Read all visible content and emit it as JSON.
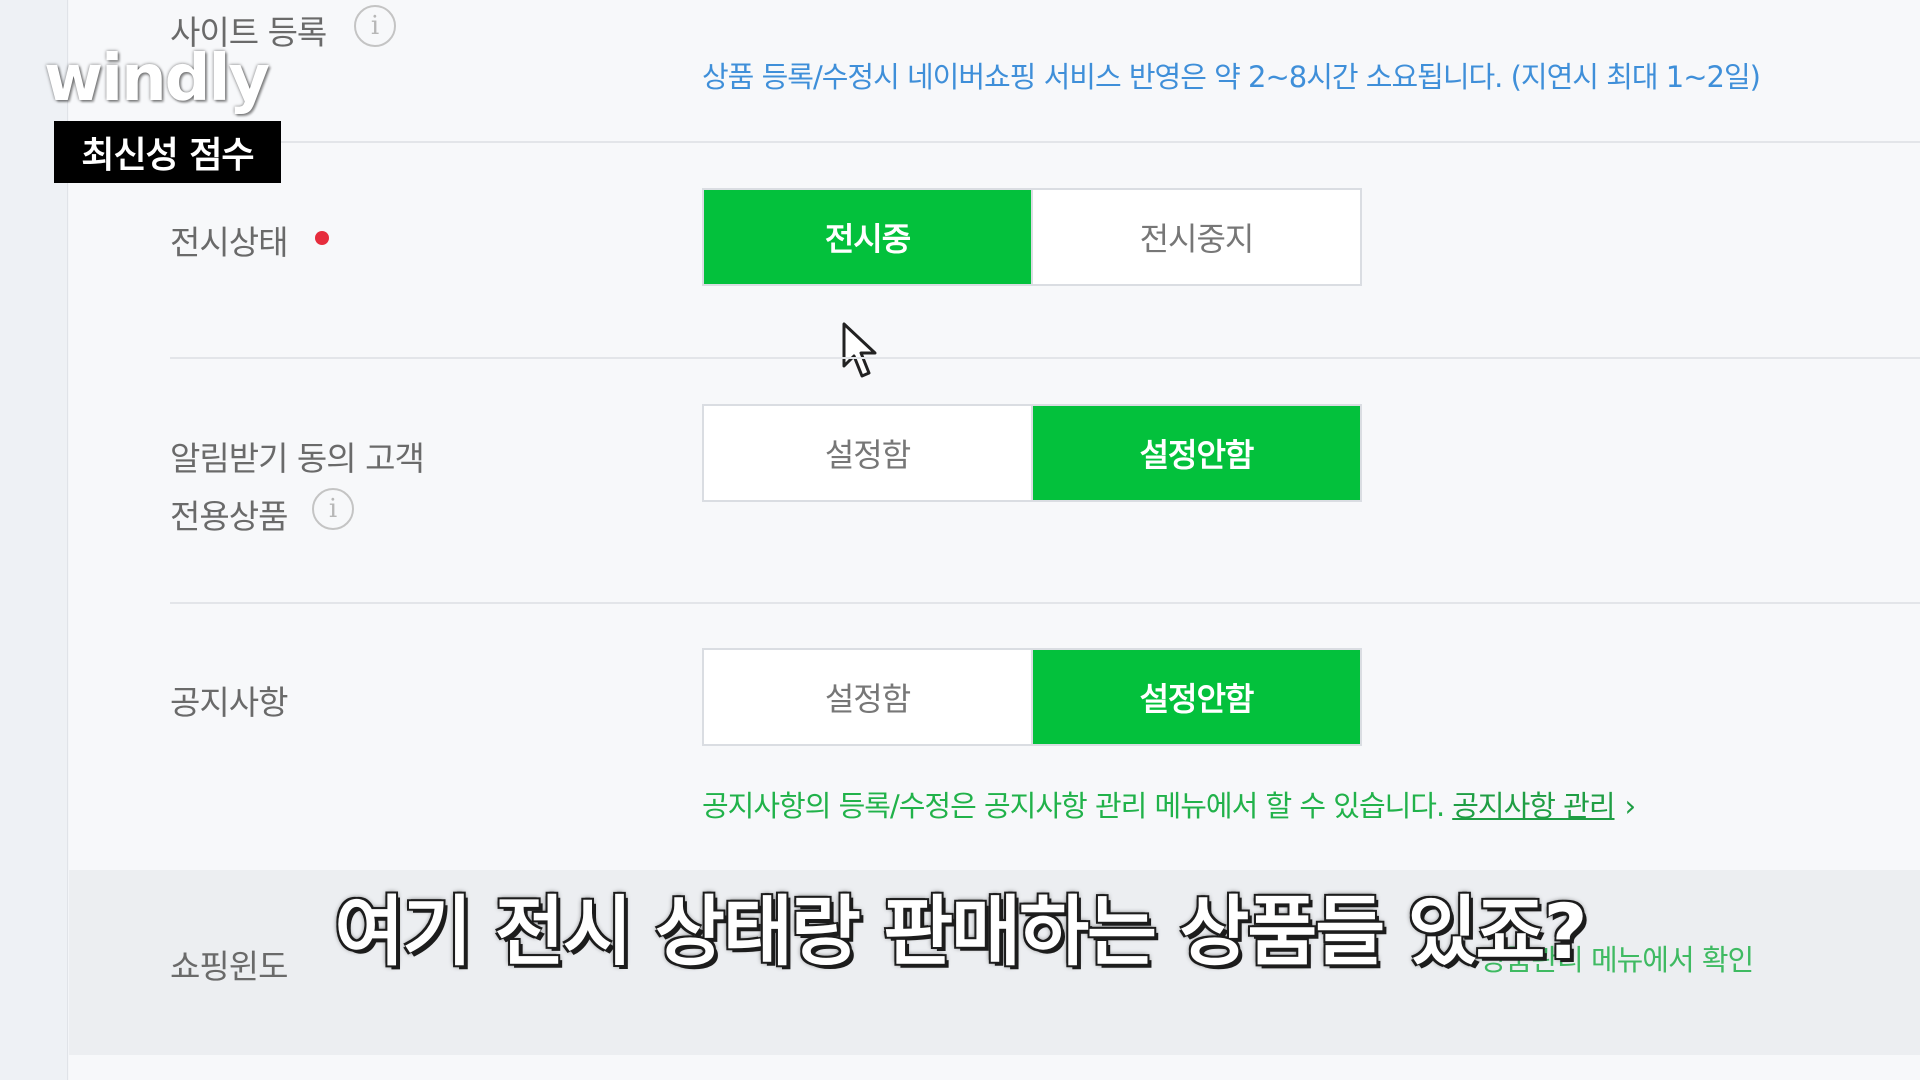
{
  "overlay": {
    "brand": "windly",
    "badge": "최신성 점수",
    "subtitle": "여기 전시 상태랑 판매하는 상품들 있죠?"
  },
  "form": {
    "site_registration": {
      "label": "사이트 등록",
      "notice": "상품 등록/수정시 네이버쇼핑 서비스 반영은 약 2~8시간 소요됩니다. (지연시 최대 1~2일)"
    },
    "display_status": {
      "label": "전시상태",
      "options": [
        "전시중",
        "전시중지"
      ],
      "selected": "전시중"
    },
    "notify_consent": {
      "label_line1": "알림받기 동의 고객",
      "label_line2": "전용상품",
      "options": [
        "설정함",
        "설정안함"
      ],
      "selected": "설정안함"
    },
    "notice": {
      "label": "공지사항",
      "options": [
        "설정함",
        "설정안함"
      ],
      "selected": "설정안함",
      "help": "공지사항의 등록/수정은 공지사항 관리 메뉴에서 할 수 있습니다.",
      "link": "공지사항 관리"
    },
    "shopping_window": {
      "label": "쇼핑윈도",
      "help_tail": "상품관리 메뉴에서 확인"
    }
  },
  "icons": {
    "info": "info-icon",
    "required": "required-dot",
    "cursor": "mouse-cursor-icon",
    "chevron": "chevron-right-icon"
  },
  "colors": {
    "active_green": "#03c13c",
    "hint_blue": "#3f8fd9",
    "hint_green": "#21b24a",
    "required_red": "#e62d3d"
  }
}
